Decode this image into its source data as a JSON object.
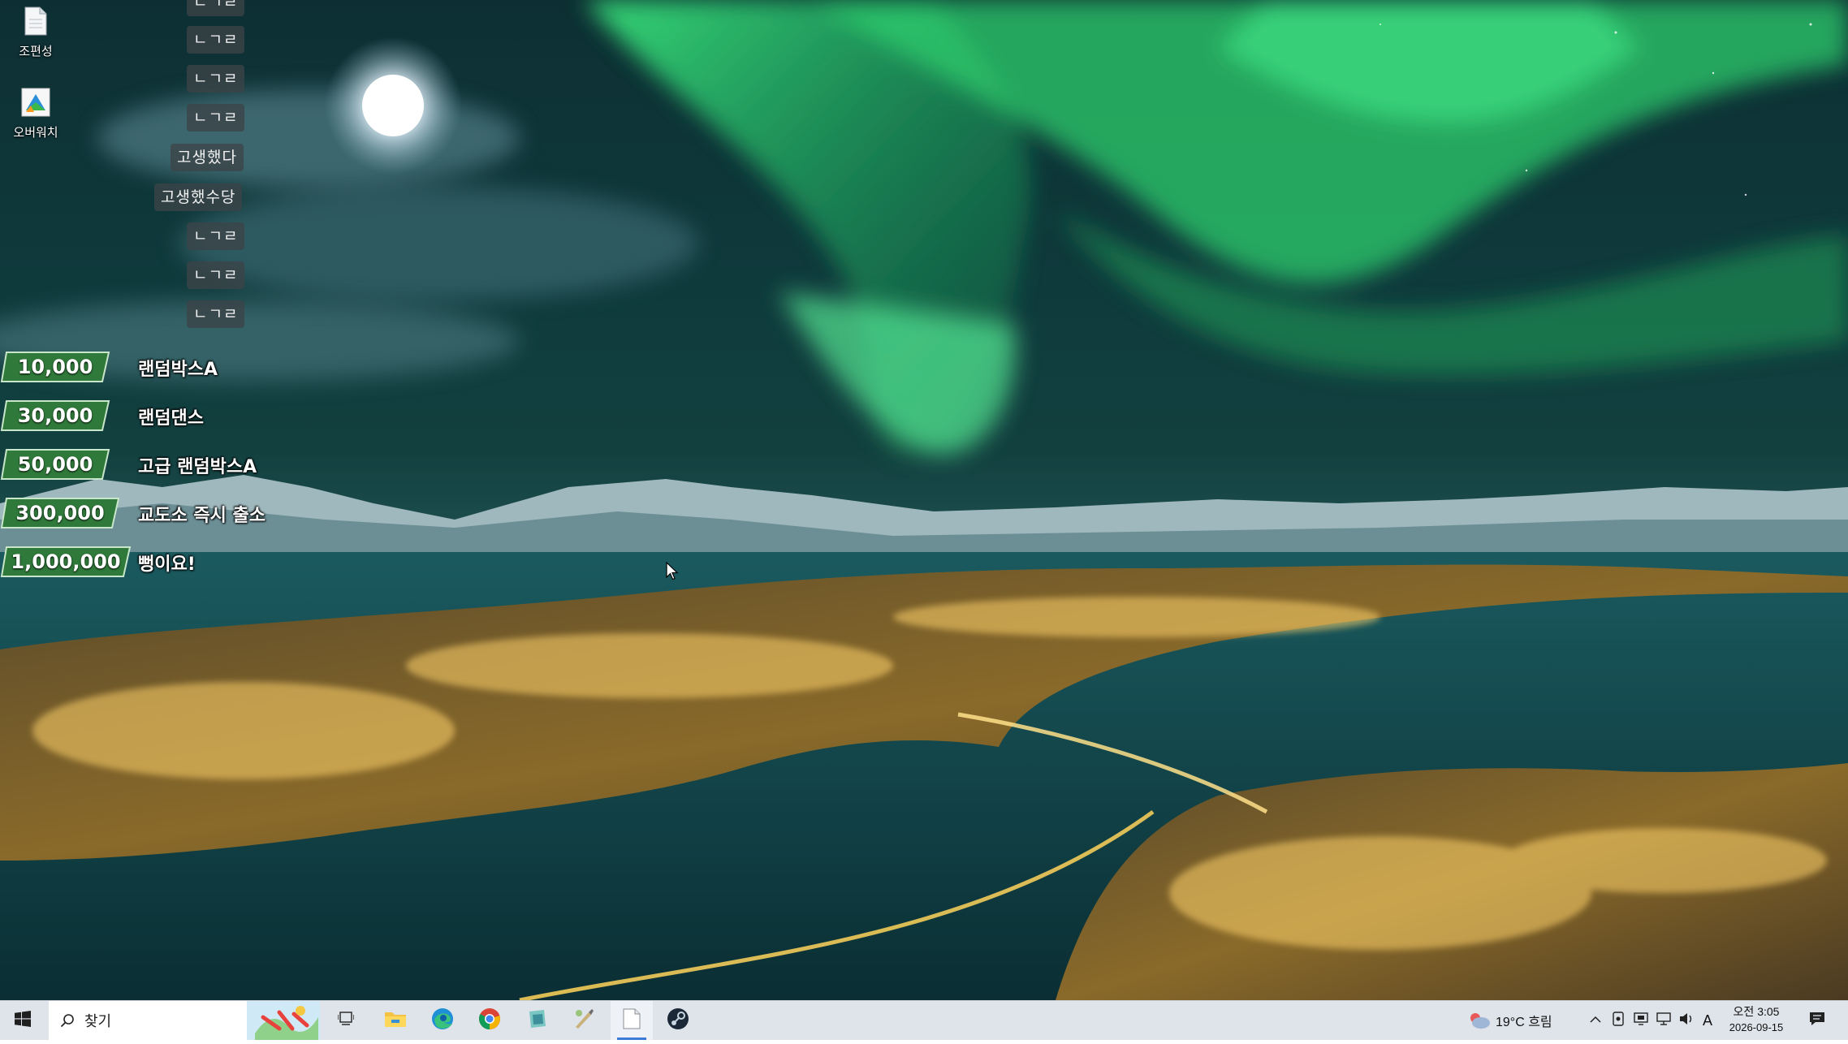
{
  "desktop": {
    "icons": [
      {
        "label": "조편성",
        "icon": "document-icon"
      },
      {
        "label": "오버워치",
        "icon": "overwatch-app-icon"
      }
    ]
  },
  "overlay": {
    "chat_lines": [
      "ㄴㄱㄹ",
      "ㄴㄱㄹ",
      "ㄴㄱㄹ",
      "ㄴㄱㄹ",
      "고생했다",
      "고생했수당",
      "ㄴㄱㄹ",
      "ㄴㄱㄹ",
      "ㄴㄱㄹ"
    ],
    "donation_tiers": [
      {
        "amount": "10,000",
        "reward": "랜덤박스A"
      },
      {
        "amount": "30,000",
        "reward": "랜덤댄스"
      },
      {
        "amount": "50,000",
        "reward": "고급 랜덤박스A"
      },
      {
        "amount": "300,000",
        "reward": "교도소 즉시 출소"
      },
      {
        "amount": "1,000,000",
        "reward": "뻥이요!"
      }
    ],
    "accent": "#2f7a3a"
  },
  "taskbar": {
    "search_label": "찾기",
    "weather": "19°C 흐림",
    "ime": "A",
    "time": "오전 3:05",
    "date": "2026-09-15",
    "apps": [
      "windows-start-icon",
      "task-view-icon",
      "file-explorer-icon",
      "edge-icon",
      "chrome-icon",
      "app-icon",
      "paint-tool-icon",
      "notepad-icon",
      "steam-icon"
    ]
  }
}
